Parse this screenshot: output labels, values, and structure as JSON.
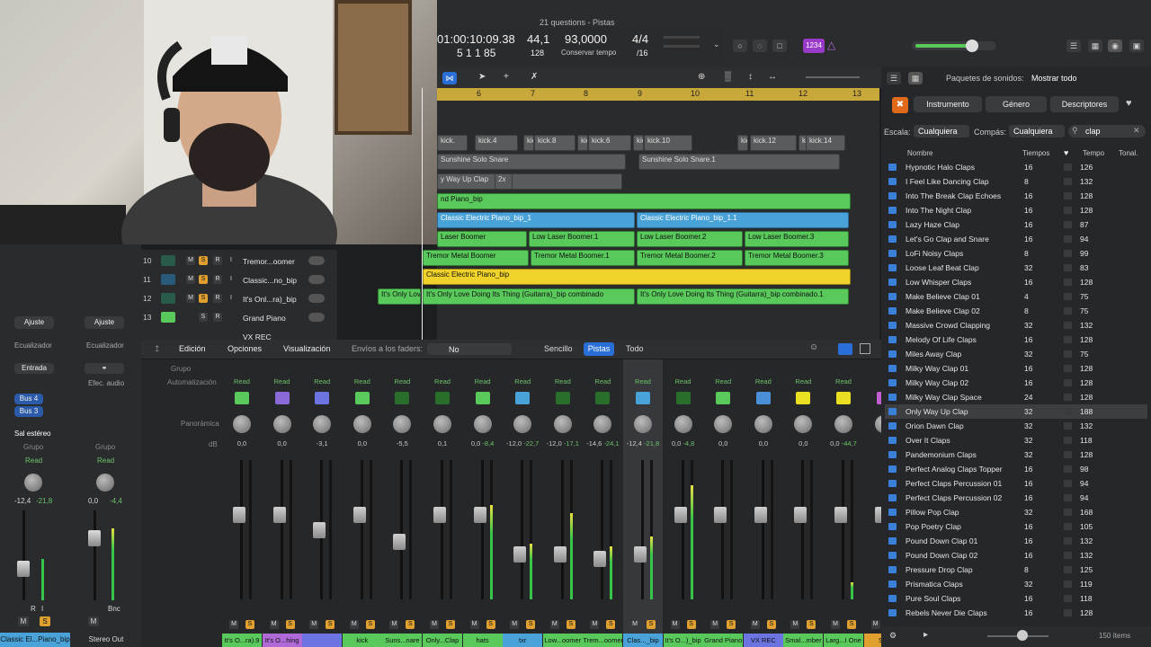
{
  "window_title": "21 questions - Pistas",
  "lcd": {
    "time": "01:00:10:09.38",
    "bars": "5 1 1 85",
    "tempo_major": "44,1",
    "tempo_minor": "128",
    "bpm": "93,0000",
    "bpm_label": "Conservar tempo",
    "sig_top": "4/4",
    "sig_bottom": "/16"
  },
  "badge": "1234",
  "ruler": [
    "6",
    "7",
    "8",
    "9",
    "10",
    "11",
    "12",
    "13"
  ],
  "regions": [
    {
      "label": "kick.",
      "cls": "rg-grey"
    },
    {
      "label": "kick.4",
      "cls": "rg-grey"
    },
    {
      "label": "kic",
      "cls": "rg-grey"
    },
    {
      "label": "kick.8",
      "cls": "rg-grey"
    },
    {
      "label": "kic",
      "cls": "rg-grey"
    },
    {
      "label": "kick.6",
      "cls": "rg-grey"
    },
    {
      "label": "kic",
      "cls": "rg-grey"
    },
    {
      "label": "kick.10",
      "cls": "rg-grey"
    },
    {
      "label": "kic",
      "cls": "rg-grey"
    },
    {
      "label": "kick.12",
      "cls": "rg-grey"
    },
    {
      "label": "kic",
      "cls": "rg-grey"
    },
    {
      "label": "kick.14",
      "cls": "rg-grey"
    },
    {
      "label": "Sunshine Solo Snare",
      "cls": "rg-grey"
    },
    {
      "label": "Sunshine Solo Snare.1",
      "cls": "rg-grey"
    },
    {
      "label": "y Way Up Clap",
      "cls": "rg-grey"
    },
    {
      "label": "2x",
      "cls": "rg-grey"
    },
    {
      "label": "nd Piano_bip",
      "cls": "rg-green"
    },
    {
      "label": "Classic Electric Piano_bip_1",
      "cls": "rg-blue"
    },
    {
      "label": "Classic Electric Piano_bip_1.1",
      "cls": "rg-blue"
    },
    {
      "label": "Laser Boomer",
      "cls": "rg-green"
    },
    {
      "label": "Low Laser Boomer.1",
      "cls": "rg-green"
    },
    {
      "label": "Low Laser Boomer.2",
      "cls": "rg-green"
    },
    {
      "label": "Low Laser Boomer.3",
      "cls": "rg-green"
    },
    {
      "label": "Tremor Metal Boomer",
      "cls": "rg-green"
    },
    {
      "label": "Tremor Metal Boomer.1",
      "cls": "rg-green"
    },
    {
      "label": "Tremor Metal Boomer.2",
      "cls": "rg-green"
    },
    {
      "label": "Tremor Metal Boomer.3",
      "cls": "rg-green"
    },
    {
      "label": "Classic Electric Piano_bip",
      "cls": "rg-yellow"
    },
    {
      "label": "It's Only Lov",
      "cls": "rg-green"
    },
    {
      "label": "It's Only Love Doing Its Thing (Guitarra)_bip combinado",
      "cls": "rg-green"
    },
    {
      "label": "It's Only Love Doing Its Thing (Guitarra)_bip combinado.1",
      "cls": "rg-green"
    }
  ],
  "tracks": [
    {
      "num": "10",
      "name": "Tremor...oomer"
    },
    {
      "num": "11",
      "name": "Classic...no_bip"
    },
    {
      "num": "12",
      "name": "It's Onl...ra)_bip"
    },
    {
      "num": "13",
      "name": "Grand Piano"
    },
    {
      "num": "",
      "name": "VX REC"
    }
  ],
  "track_buttons": {
    "m": "M",
    "s": "S",
    "r": "R",
    "i": "I"
  },
  "inspector": {
    "ajuste": "Ajuste",
    "ecualizador": "Ecualizador",
    "entrada": "Entrada",
    "efec_audio": "Efec. audio",
    "bus4": "Bus 4",
    "bus3": "Bus 3",
    "sal_estereo": "Sal estéreo",
    "grupo": "Grupo",
    "read": "Read",
    "strip1_db_a": "-12,4",
    "strip1_db_b": "-21,8",
    "strip2_db_a": "0,0",
    "strip2_db_b": "-4,4",
    "bnc": "Bnc",
    "m": "M",
    "s": "S",
    "r": "R",
    "i": "I",
    "strip1_name": "Classic El...Piano_bip",
    "strip2_name": "Stereo Out"
  },
  "mixer_toolbar": {
    "edicion": "Edición",
    "opciones": "Opciones",
    "visualizacion": "Visualización",
    "envios_label": "Envíos a los faders:",
    "envios_value": "No",
    "sencillo": "Sencillo",
    "pistas": "Pistas",
    "todo": "Todo"
  },
  "mixer_labels": {
    "grupo": "Grupo",
    "automatizacion": "Automatización",
    "panoramica": "Panorámica",
    "db": "dB"
  },
  "mixer_strips": [
    {
      "db": "0,0",
      "read": "Read",
      "label": "It's O...ra).9",
      "color": "#58c95a",
      "icon_color": "#58c95a",
      "level": 0.62,
      "meter": 0.0
    },
    {
      "db": "0,0",
      "read": "Read",
      "label": "It's O...hing",
      "color": "#b06ad8",
      "icon_color": "#8a6ad8",
      "level": 0.62,
      "meter": 0.0
    },
    {
      "db": "-3,1",
      "read": "Read",
      "label": "",
      "color": "#6b74e0",
      "icon_color": "#6b74e0",
      "level": 0.5,
      "meter": 0.0
    },
    {
      "db": "0,0",
      "read": "Read",
      "label": "kick",
      "color": "#58c95a",
      "icon_color": "#58c95a",
      "level": 0.62,
      "meter": 0.0
    },
    {
      "db": "-5,5",
      "read": "Read",
      "label": "Suns...nare",
      "color": "#58c95a",
      "icon_color": "#2a6e2c",
      "level": 0.4,
      "meter": 0.0
    },
    {
      "db": "0,1",
      "read": "Read",
      "label": "Only...Clap",
      "color": "#58c95a",
      "icon_color": "#2a6e2c",
      "level": 0.62,
      "meter": 0.0
    },
    {
      "db": "0,0",
      "read": "Read",
      "label": "hats",
      "color": "#58c95a",
      "icon_color": "#58c95a",
      "level": 0.62,
      "meter": 0.68,
      "peak": "-8,4"
    },
    {
      "db": "-12,0",
      "read": "Read",
      "label": "txr",
      "color": "#4aa3d8",
      "icon_color": "#4aa3d8",
      "level": 0.3,
      "meter": 0.4,
      "peak": "-22,7"
    },
    {
      "db": "-12,0",
      "read": "Read",
      "label": "Low...oomer",
      "color": "#58c95a",
      "icon_color": "#2a6e2c",
      "level": 0.3,
      "meter": 0.62,
      "peak": "-17,1"
    },
    {
      "db": "-14,6",
      "read": "Read",
      "label": "Trem...oomer",
      "color": "#58c95a",
      "icon_color": "#2a6e2c",
      "level": 0.26,
      "meter": 0.38,
      "peak": "-24,1"
    },
    {
      "db": "-12,4",
      "read": "Read",
      "label": "Clas..._bip",
      "color": "#4aa3d8",
      "icon_color": "#4aa3d8",
      "level": 0.3,
      "meter": 0.45,
      "peak": "-21,8"
    },
    {
      "db": "0,0",
      "read": "Read",
      "label": "It's O...)_bip",
      "color": "#58c95a",
      "icon_color": "#2a6e2c",
      "level": 0.62,
      "meter": 0.82,
      "peak": "-4,8"
    },
    {
      "db": "0,0",
      "read": "Read",
      "label": "Grand Piano",
      "color": "#58c95a",
      "icon_color": "#58c95a",
      "level": 0.62,
      "meter": 0.0
    },
    {
      "db": "0,0",
      "read": "Read",
      "label": "VX REC",
      "color": "#6b74e0",
      "icon_color": "#4a8fd8",
      "level": 0.62,
      "meter": 0.0
    },
    {
      "db": "0,0",
      "read": "Read",
      "label": "Smal...mber",
      "color": "#58c95a",
      "icon_color": "#e8e020",
      "level": 0.62,
      "meter": 0.0
    },
    {
      "db": "0,0",
      "read": "Read",
      "label": "Larg...I One",
      "color": "#58c95a",
      "icon_color": "#e8e020",
      "level": 0.62,
      "meter": 0.12,
      "peak": "-44,7"
    },
    {
      "db": "",
      "read": "R",
      "label": "Ste",
      "color": "#e0a030",
      "icon_color": "#c060d0",
      "level": 0.62,
      "meter": 0.0
    }
  ],
  "strip_buttons": {
    "m": "M",
    "s": "S",
    "r": "R",
    "i": "I"
  },
  "browser": {
    "header": "Paquetes de sonidos:",
    "header_value": "Mostrar todo",
    "tab_instrumento": "Instrumento",
    "tab_genero": "Género",
    "tab_descriptores": "Descriptores",
    "escala_label": "Escala:",
    "escala_value": "Cualquiera",
    "compas_label": "Compás:",
    "compas_value": "Cualquiera",
    "search_value": "clap",
    "col_nombre": "Nombre",
    "col_tiempos": "Tiempos",
    "col_tempo": "Tempo",
    "col_tonal": "Tonal.",
    "items_count": "150 ítems",
    "items": [
      {
        "name": "Hypnotic Halo Claps",
        "beats": "16",
        "tempo": "126"
      },
      {
        "name": "I Feel Like Dancing Clap",
        "beats": "8",
        "tempo": "132"
      },
      {
        "name": "Into The Break Clap Echoes",
        "beats": "16",
        "tempo": "128"
      },
      {
        "name": "Into The Night Clap",
        "beats": "16",
        "tempo": "128"
      },
      {
        "name": "Lazy Haze Clap",
        "beats": "16",
        "tempo": "87"
      },
      {
        "name": "Let's Go Clap and Snare",
        "beats": "16",
        "tempo": "94"
      },
      {
        "name": "LoFi Noisy Claps",
        "beats": "8",
        "tempo": "99"
      },
      {
        "name": "Loose Leaf Beat Clap",
        "beats": "32",
        "tempo": "83"
      },
      {
        "name": "Low Whisper Claps",
        "beats": "16",
        "tempo": "128"
      },
      {
        "name": "Make Believe Clap 01",
        "beats": "4",
        "tempo": "75"
      },
      {
        "name": "Make Believe Clap 02",
        "beats": "8",
        "tempo": "75"
      },
      {
        "name": "Massive Crowd Clapping",
        "beats": "32",
        "tempo": "132"
      },
      {
        "name": "Melody Of Life Claps",
        "beats": "16",
        "tempo": "128"
      },
      {
        "name": "Miles Away Clap",
        "beats": "32",
        "tempo": "75"
      },
      {
        "name": "Milky Way Clap 01",
        "beats": "16",
        "tempo": "128"
      },
      {
        "name": "Milky Way Clap 02",
        "beats": "16",
        "tempo": "128"
      },
      {
        "name": "Milky Way Clap Space",
        "beats": "24",
        "tempo": "128"
      },
      {
        "name": "Only Way Up Clap",
        "beats": "32",
        "tempo": "188",
        "selected": true
      },
      {
        "name": "Orion Dawn Clap",
        "beats": "32",
        "tempo": "132"
      },
      {
        "name": "Over It Claps",
        "beats": "32",
        "tempo": "118"
      },
      {
        "name": "Pandemonium Claps",
        "beats": "32",
        "tempo": "128"
      },
      {
        "name": "Perfect Analog Claps Topper",
        "beats": "16",
        "tempo": "98"
      },
      {
        "name": "Perfect Claps Percussion 01",
        "beats": "16",
        "tempo": "94"
      },
      {
        "name": "Perfect Claps Percussion 02",
        "beats": "16",
        "tempo": "94"
      },
      {
        "name": "Pillow Pop Clap",
        "beats": "32",
        "tempo": "168"
      },
      {
        "name": "Pop Poetry Clap",
        "beats": "16",
        "tempo": "105"
      },
      {
        "name": "Pound Down Clap 01",
        "beats": "16",
        "tempo": "132"
      },
      {
        "name": "Pound Down Clap 02",
        "beats": "16",
        "tempo": "132"
      },
      {
        "name": "Pressure Drop Clap",
        "beats": "8",
        "tempo": "125"
      },
      {
        "name": "Prismatica Claps",
        "beats": "32",
        "tempo": "119"
      },
      {
        "name": "Pure Soul Claps",
        "beats": "16",
        "tempo": "118"
      },
      {
        "name": "Rebels Never Die Claps",
        "beats": "16",
        "tempo": "128"
      }
    ]
  }
}
